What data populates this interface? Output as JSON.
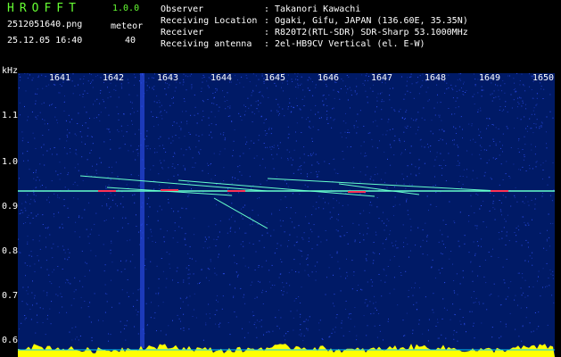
{
  "app": {
    "name": "HROFFT",
    "version": "1.0.0"
  },
  "file": {
    "name": "2512051640.png",
    "datetime": "25.12.05 16:40"
  },
  "meteor": {
    "label": "meteor",
    "count": "40"
  },
  "info": [
    {
      "key": "Observer",
      "value": "Takanori Kawachi"
    },
    {
      "key": "Receiving Location",
      "value": "Ogaki, Gifu, JAPAN (136.60E, 35.35N)"
    },
    {
      "key": "Receiver",
      "value": "R820T2(RTL-SDR) SDR-Sharp 53.1000MHz"
    },
    {
      "key": "Receiving antenna",
      "value": "2el-HB9CV Vertical (el. E-W)"
    }
  ],
  "spectrogram": {
    "y_unit": "kHz",
    "x_ticks": [
      "1641",
      "1642",
      "1643",
      "1644",
      "1645",
      "1646",
      "1647",
      "1648",
      "1649",
      "1650"
    ],
    "y_ticks": [
      "1.1",
      "1.0",
      "0.9",
      "0.8",
      "0.7",
      "0.6"
    ],
    "colors": {
      "background": "#001a66",
      "noise": "#3355ff",
      "carrier": "#66ffcc",
      "hot": "#ff3355",
      "power": "#ffff00",
      "marker": "#00ccff"
    }
  }
}
